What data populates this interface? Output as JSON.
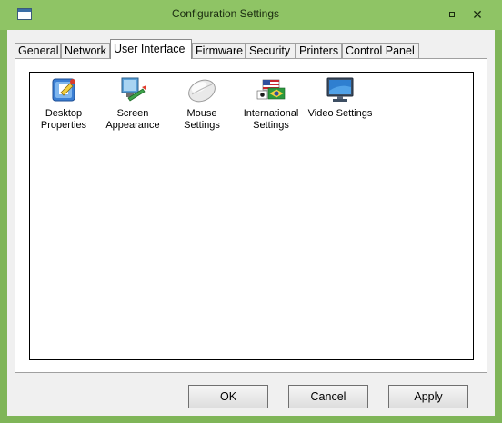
{
  "window": {
    "title": "Configuration Settings",
    "minimize_label": "–",
    "close_label": "✕"
  },
  "tabs": [
    {
      "label": "General"
    },
    {
      "label": "Network"
    },
    {
      "label": "User Interface",
      "active": true
    },
    {
      "label": "Firmware"
    },
    {
      "label": "Security"
    },
    {
      "label": "Printers"
    },
    {
      "label": "Control Panel"
    }
  ],
  "items": [
    {
      "line1": "Desktop",
      "line2": "Properties",
      "icon": "desktop-properties-icon"
    },
    {
      "line1": "Screen",
      "line2": "Appearance",
      "icon": "screen-appearance-icon"
    },
    {
      "line1": "Mouse",
      "line2": "Settings",
      "icon": "mouse-icon"
    },
    {
      "line1": "International",
      "line2": "Settings",
      "icon": "international-flags-icon"
    },
    {
      "line1": "Video Settings",
      "line2": "",
      "icon": "monitor-icon"
    }
  ],
  "buttons": {
    "ok": "OK",
    "cancel": "Cancel",
    "apply": "Apply"
  },
  "colors": {
    "frame": "#8fc465",
    "client": "#f0f0f0",
    "panel": "#ffffff"
  }
}
